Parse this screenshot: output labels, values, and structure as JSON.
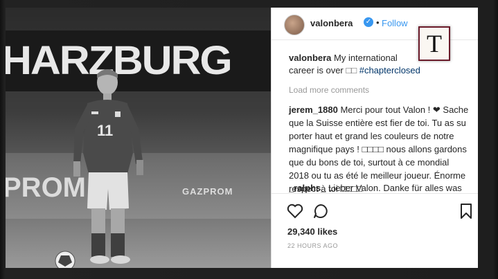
{
  "post": {
    "photo": {
      "banner_text": "HARZBURG",
      "board_text": "PROM",
      "sponsor_text": "GAZPROM",
      "shirt_number": "11"
    },
    "header": {
      "username": "valonbera",
      "verified_icon": "verified-badge-icon",
      "separator": "•",
      "follow_label": "Follow"
    },
    "watermark_letter": "T",
    "caption": {
      "username": "valonbera",
      "text": "My international career is over",
      "emoji": "□□",
      "hashtag": "#chapterclosed"
    },
    "load_more": "Load more comments",
    "comments": [
      {
        "username": "jerem_1880",
        "text": "Merci pour tout Valon ! ❤ Sache que la Suisse entière est fier de toi. Tu as su porter haut et grand les couleurs de notre magnifique pays ! □□□□ nous allons gardons que du bons de toi, surtout à ce mondial 2018 ou tu as été le meilleur joueur. Énorme respect à toi □□□□"
      },
      {
        "username": "_ralphs_",
        "text": "Lieber Valon. Danke für alles was"
      }
    ],
    "actions": {
      "like_icon": "heart-icon",
      "comment_icon": "comment-icon",
      "save_icon": "bookmark-icon"
    },
    "likes": "29,340 likes",
    "timestamp": "22 HOURS AGO",
    "colors": {
      "link": "#3897f0",
      "hashtag": "#003569",
      "muted": "#999999",
      "text": "#262626"
    }
  }
}
